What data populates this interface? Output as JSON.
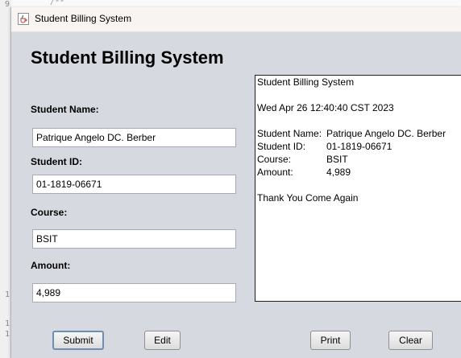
{
  "background": {
    "gutter_numbers": [
      "9",
      "1",
      "1",
      "1"
    ],
    "code_fragment": "/**"
  },
  "window": {
    "title": "Student Billing System",
    "icon": "java-cup-icon"
  },
  "form": {
    "heading": "Student Billing System",
    "name_label": "Student Name:",
    "name_value": "Patrique Angelo DC. Berber",
    "id_label": "Student ID:",
    "id_value": "01-1819-06671",
    "course_label": "Course:",
    "course_value": "BSIT",
    "amount_label": "Amount:",
    "amount_value": "4,989"
  },
  "receipt": {
    "title": "Student Billing System",
    "datetime": "Wed Apr 26 12:40:40 CST 2023",
    "rows": [
      {
        "label": "Student Name:",
        "value": "Patrique Angelo DC. Berber"
      },
      {
        "label": "Student ID:",
        "value": "01-1819-06671"
      },
      {
        "label": "Course:",
        "value": "BSIT"
      },
      {
        "label": "Amount:",
        "value": "4,989"
      }
    ],
    "footer": "Thank You Come Again"
  },
  "buttons": {
    "submit": "Submit",
    "edit": "Edit",
    "print": "Print",
    "clear": "Clear"
  },
  "colors": {
    "window_bg": "#d6d9e0",
    "focus_border": "#6d8fb4"
  }
}
